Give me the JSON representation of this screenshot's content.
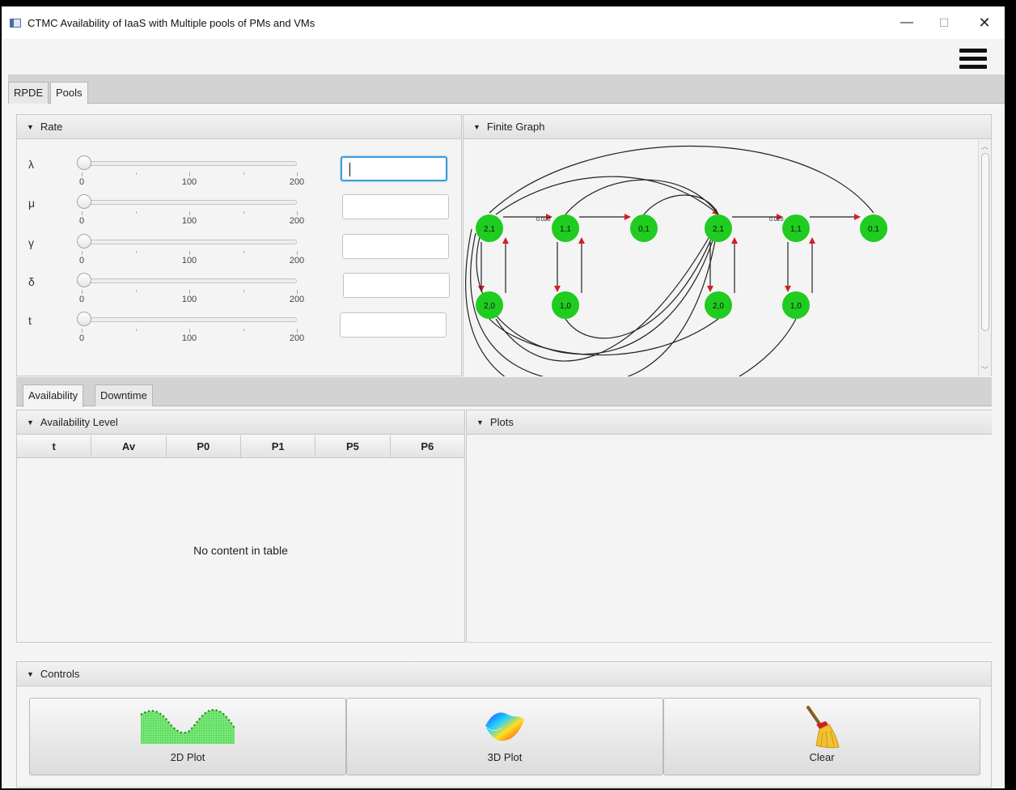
{
  "window": {
    "title": "CTMC Availability of IaaS with Multiple pools of PMs and VMs"
  },
  "window_controls": {
    "minimize": "—",
    "maximize": "☐",
    "close": "✕"
  },
  "main_tabs": [
    {
      "label": "RPDE",
      "active": false
    },
    {
      "label": "Pools",
      "active": true
    }
  ],
  "rate_panel": {
    "title": "Rate",
    "rows": [
      {
        "label": "λ",
        "min": "0",
        "mid": "100",
        "max": "200",
        "value": 0,
        "input": ""
      },
      {
        "label": "μ",
        "min": "0",
        "mid": "100",
        "max": "200",
        "value": 0,
        "input": ""
      },
      {
        "label": "γ",
        "min": "0",
        "mid": "100",
        "max": "200",
        "value": 0,
        "input": ""
      },
      {
        "label": "δ",
        "min": "0",
        "mid": "100",
        "max": "200",
        "value": 0,
        "input": ""
      },
      {
        "label": "t",
        "min": "0",
        "mid": "100",
        "max": "200",
        "value": 0,
        "input": ""
      }
    ]
  },
  "graph_panel": {
    "title": "Finite Graph",
    "node_color": "#1fcc1f",
    "edge_label": "0.020",
    "nodes": [
      "2,1",
      "1,1",
      "0,1",
      "2,1",
      "1,1",
      "0,1",
      "2,0",
      "1,0",
      "2,0",
      "1,0"
    ]
  },
  "result_tabs": [
    {
      "label": "Availability",
      "active": true
    },
    {
      "label": "Downtime",
      "active": false
    }
  ],
  "availability_panel": {
    "title": "Availability Level",
    "columns": [
      "t",
      "Av",
      "P0",
      "P1",
      "P5",
      "P6"
    ],
    "empty_text": "No content in table"
  },
  "plots_panel": {
    "title": "Plots"
  },
  "controls_panel": {
    "title": "Controls",
    "buttons": [
      {
        "label": "2D Plot",
        "icon": "2d-plot-icon"
      },
      {
        "label": "3D Plot",
        "icon": "3d-plot-icon"
      },
      {
        "label": "Clear",
        "icon": "broom-icon"
      }
    ]
  },
  "colors": {
    "focus": "#3a9ad9",
    "node": "#1fcc1f",
    "arrow": "#d0202a"
  }
}
